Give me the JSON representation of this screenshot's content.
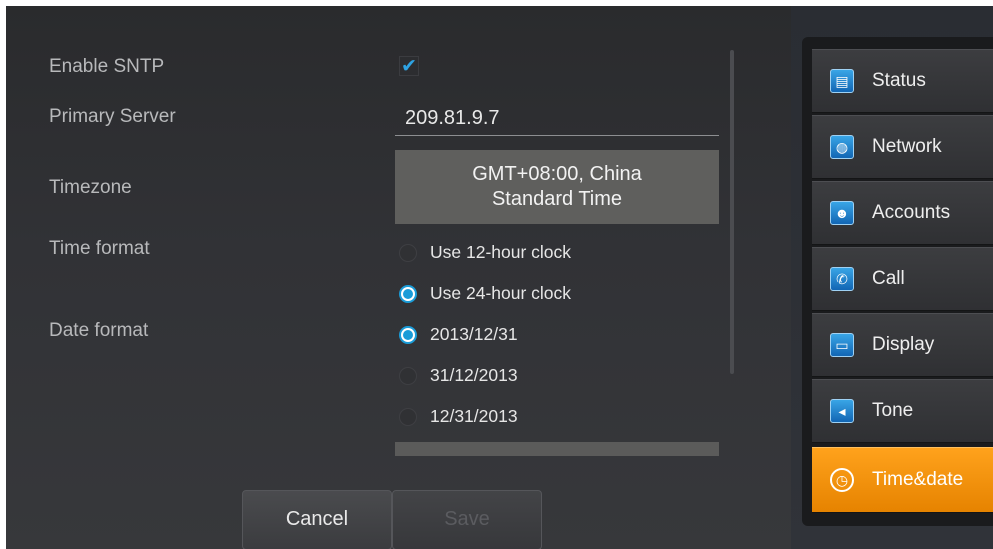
{
  "form": {
    "sntp_label": "Enable SNTP",
    "sntp_checked": true,
    "primary_server_label": "Primary Server",
    "primary_server_value": "209.81.9.7",
    "timezone_label": "Timezone",
    "timezone_value_line1": "GMT+08:00, China",
    "timezone_value_line2": "Standard Time",
    "time_format_label": "Time format",
    "time_format_options": [
      "Use 12-hour clock",
      "Use 24-hour clock"
    ],
    "time_format_selected": "Use 24-hour clock",
    "date_format_label": "Date format",
    "date_format_options": [
      "2013/12/31",
      "31/12/2013",
      "12/31/2013"
    ],
    "date_format_selected": "2013/12/31"
  },
  "buttons": {
    "cancel": "Cancel",
    "save": "Save"
  },
  "menu": {
    "items": [
      {
        "label": "Status",
        "icon": "status-icon"
      },
      {
        "label": "Network",
        "icon": "globe-icon"
      },
      {
        "label": "Accounts",
        "icon": "accounts-icon"
      },
      {
        "label": "Call",
        "icon": "phone-icon"
      },
      {
        "label": "Display",
        "icon": "monitor-icon"
      },
      {
        "label": "Tone",
        "icon": "speaker-icon"
      },
      {
        "label": "Time&date",
        "icon": "clock-icon"
      }
    ],
    "active": "Time&date"
  },
  "colors": {
    "accent_blue": "#1a9cd8",
    "active_orange": "#f39000"
  }
}
